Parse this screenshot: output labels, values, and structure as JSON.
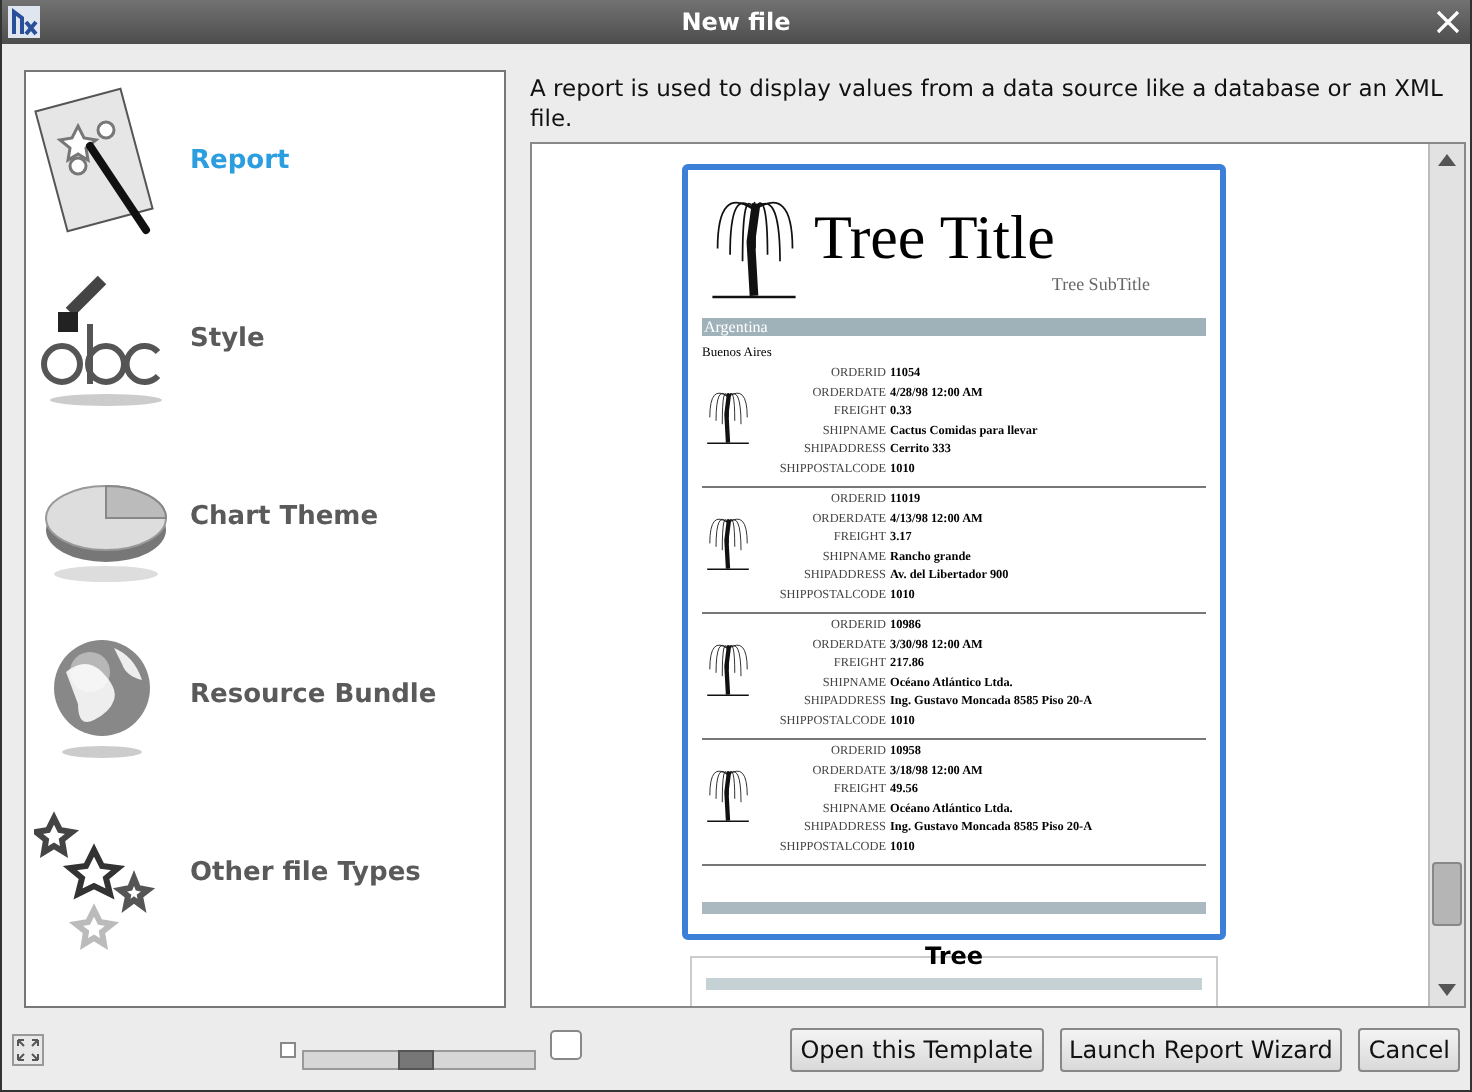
{
  "window": {
    "title": "New file"
  },
  "sidebar": {
    "items": [
      {
        "label": "Report",
        "kind": "report",
        "selected": true
      },
      {
        "label": "Style",
        "kind": "style",
        "selected": false
      },
      {
        "label": "Chart Theme",
        "kind": "chart",
        "selected": false
      },
      {
        "label": "Resource Bundle",
        "kind": "bundle",
        "selected": false
      },
      {
        "label": "Other file Types",
        "kind": "other",
        "selected": false
      }
    ]
  },
  "description": "A report is used to display values from a data source like a database or an XML file.",
  "preview": {
    "title": "Tree Title",
    "subtitle": "Tree SubTitle",
    "group": "Argentina",
    "city": "Buenos Aires",
    "records": [
      {
        "fields": [
          {
            "label": "ORDERID",
            "value": "11054"
          },
          {
            "label": "ORDERDATE",
            "value": "4/28/98 12:00 AM"
          },
          {
            "label": "FREIGHT",
            "value": "0.33"
          },
          {
            "label": "SHIPNAME",
            "value": "Cactus Comidas para llevar"
          },
          {
            "label": "SHIPADDRESS",
            "value": "Cerrito 333"
          },
          {
            "label": "SHIPPOSTALCODE",
            "value": "1010"
          }
        ]
      },
      {
        "fields": [
          {
            "label": "ORDERID",
            "value": "11019"
          },
          {
            "label": "ORDERDATE",
            "value": "4/13/98 12:00 AM"
          },
          {
            "label": "FREIGHT",
            "value": "3.17"
          },
          {
            "label": "SHIPNAME",
            "value": "Rancho grande"
          },
          {
            "label": "SHIPADDRESS",
            "value": "Av. del Libertador 900"
          },
          {
            "label": "SHIPPOSTALCODE",
            "value": "1010"
          }
        ]
      },
      {
        "fields": [
          {
            "label": "ORDERID",
            "value": "10986"
          },
          {
            "label": "ORDERDATE",
            "value": "3/30/98 12:00 AM"
          },
          {
            "label": "FREIGHT",
            "value": "217.86"
          },
          {
            "label": "SHIPNAME",
            "value": "Océano Atlántico Ltda."
          },
          {
            "label": "SHIPADDRESS",
            "value": "Ing. Gustavo Moncada 8585 Piso 20-A"
          },
          {
            "label": "SHIPPOSTALCODE",
            "value": "1010"
          }
        ]
      },
      {
        "fields": [
          {
            "label": "ORDERID",
            "value": "10958"
          },
          {
            "label": "ORDERDATE",
            "value": "3/18/98 12:00 AM"
          },
          {
            "label": "FREIGHT",
            "value": "49.56"
          },
          {
            "label": "SHIPNAME",
            "value": "Océano Atlántico Ltda."
          },
          {
            "label": "SHIPADDRESS",
            "value": "Ing. Gustavo Moncada 8585 Piso 20-A"
          },
          {
            "label": "SHIPPOSTALCODE",
            "value": "1010"
          }
        ]
      }
    ],
    "caption": "Tree"
  },
  "zoom_slider": {
    "level": 0.49
  },
  "buttons": [
    {
      "label": "Open this Template"
    },
    {
      "label": "Launch Report Wizard"
    },
    {
      "label": "Cancel"
    }
  ]
}
